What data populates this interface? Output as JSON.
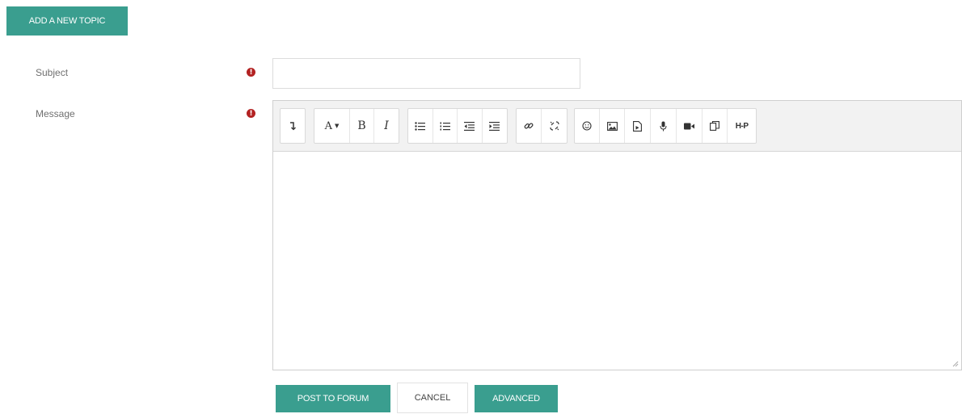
{
  "header": {
    "add_topic_label": "ADD A NEW TOPIC"
  },
  "form": {
    "subject": {
      "label": "Subject",
      "value": "",
      "required_icon": "exclamation-circle-icon"
    },
    "message": {
      "label": "Message",
      "value": "",
      "required_icon": "exclamation-circle-icon"
    }
  },
  "editor": {
    "font_button_label": "A",
    "bold_label": "B",
    "italic_label": "I",
    "h5p_label": "H-P"
  },
  "actions": {
    "post_label": "POST TO FORUM",
    "cancel_label": "CANCEL",
    "advanced_label": "ADVANCED"
  },
  "colors": {
    "accent": "#3a9e8f",
    "required": "#b32222"
  }
}
